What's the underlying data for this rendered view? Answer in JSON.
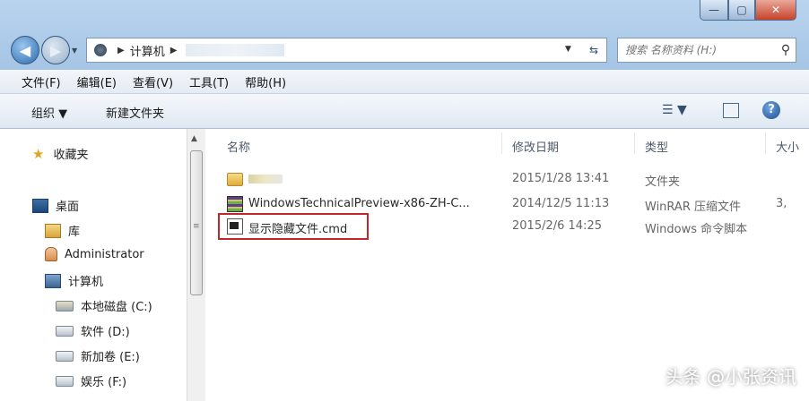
{
  "window": {
    "min_label": "—",
    "max_label": "▢",
    "close_label": "✕"
  },
  "nav": {
    "back_label": "◀",
    "forward_label": "▶",
    "address": {
      "icon": "computer-icon",
      "separator": "▶",
      "crumb": "计算机"
    },
    "search_placeholder": "搜索 名称资料 (H:)"
  },
  "menubar": {
    "items": [
      "文件(F)",
      "编辑(E)",
      "查看(V)",
      "工具(T)",
      "帮助(H)"
    ]
  },
  "toolbar": {
    "organize": "组织 ▼",
    "new_folder": "新建文件夹",
    "views_label": "☰ ▼",
    "help_label": "?"
  },
  "sidebar": {
    "favorites": "收藏夹",
    "items": [
      {
        "label": "桌面",
        "icon": "desktop-icon"
      },
      {
        "label": "库",
        "icon": "library-icon"
      },
      {
        "label": "Administrator",
        "icon": "user-icon"
      },
      {
        "label": "计算机",
        "icon": "computer-icon"
      },
      {
        "label": "本地磁盘 (C:)",
        "icon": "system-drive-icon"
      },
      {
        "label": "软件 (D:)",
        "icon": "drive-icon"
      },
      {
        "label": "新加卷 (E:)",
        "icon": "drive-icon"
      },
      {
        "label": "娱乐 (F:)",
        "icon": "drive-icon"
      }
    ]
  },
  "file_list": {
    "columns": [
      "名称",
      "修改日期",
      "类型",
      "大小"
    ],
    "rows": [
      {
        "name": "",
        "date": "2015/1/28 13:41",
        "type": "文件夹",
        "size": "",
        "icon": "folder-icon"
      },
      {
        "name": "WindowsTechnicalPreview-x86-ZH-C...",
        "date": "2014/12/5 11:13",
        "type": "WinRAR 压缩文件",
        "size": "3,",
        "icon": "winrar-icon"
      },
      {
        "name": "显示隐藏文件.cmd",
        "date": "2015/2/6 14:25",
        "type": "Windows 命令脚本",
        "size": "",
        "icon": "cmd-icon"
      }
    ],
    "highlighted_row": 2,
    "highlight_color": "#c0262c"
  },
  "watermark": "头条 @小张资讯"
}
